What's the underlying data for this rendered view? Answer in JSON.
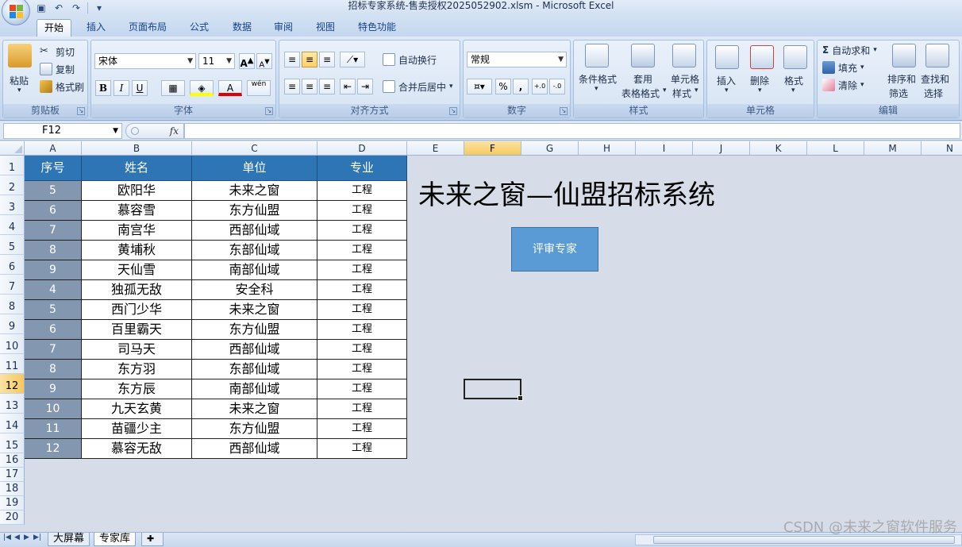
{
  "window": {
    "title": "招标专家系统-售卖授权2025052902.xlsm  -  Microsoft Excel"
  },
  "ribbon": {
    "tabs": [
      "开始",
      "插入",
      "页面布局",
      "公式",
      "数据",
      "审阅",
      "视图",
      "特色功能"
    ],
    "active_tab": "开始",
    "clipboard": {
      "paste": "粘贴",
      "cut": "剪切",
      "copy": "复制",
      "format_painter": "格式刷",
      "label": "剪贴板"
    },
    "font": {
      "family": "宋体",
      "size": "11",
      "label": "字体",
      "bold": "B",
      "italic": "I",
      "underline": "U",
      "grow": "A",
      "shrink": "A",
      "font_color_glyph": "A",
      "phonetic": "wén"
    },
    "alignment": {
      "wrap": "自动换行",
      "merge": "合并后居中",
      "label": "对齐方式"
    },
    "number": {
      "format": "常规",
      "percent": "%",
      "comma": ",",
      "label": "数字",
      "inc_decimal": "+.0",
      "dec_decimal": "-.0"
    },
    "styles": {
      "conditional": "条件格式",
      "table_format_1": "套用",
      "table_format_2": "表格格式",
      "cell_style_1": "单元格",
      "cell_style_2": "样式",
      "label": "样式"
    },
    "cells": {
      "insert": "插入",
      "delete": "删除",
      "format": "格式",
      "label": "单元格"
    },
    "editing": {
      "autosum": "自动求和",
      "fill": "填充",
      "clear": "清除",
      "sort_1": "排序和",
      "sort_2": "筛选",
      "find_1": "查找和",
      "find_2": "选择",
      "label": "编辑"
    }
  },
  "formula_bar": {
    "name_box": "F12",
    "fx": "fx",
    "formula": ""
  },
  "columns": [
    "A",
    "B",
    "C",
    "D",
    "E",
    "F",
    "G",
    "H",
    "I",
    "J",
    "K",
    "L",
    "M",
    "N"
  ],
  "selected_column": "F",
  "rows": [
    "1",
    "2",
    "3",
    "4",
    "5",
    "6",
    "7",
    "8",
    "9",
    "10",
    "11",
    "12",
    "13",
    "14",
    "15",
    "16",
    "17",
    "18",
    "19",
    "20"
  ],
  "selected_row": "12",
  "table": {
    "headers": [
      "序号",
      "姓名",
      "单位",
      "专业"
    ],
    "rows": [
      [
        "5",
        "欧阳华",
        "未来之窗",
        "工程"
      ],
      [
        "6",
        "慕容雪",
        "东方仙盟",
        "工程"
      ],
      [
        "7",
        "南宫华",
        "西部仙域",
        "工程"
      ],
      [
        "8",
        "黄埔秋",
        "东部仙域",
        "工程"
      ],
      [
        "9",
        "天仙雪",
        "南部仙域",
        "工程"
      ],
      [
        "4",
        "独孤无敌",
        "安全科",
        "工程"
      ],
      [
        "5",
        "西门少华",
        "未来之窗",
        "工程"
      ],
      [
        "6",
        "百里霸天",
        "东方仙盟",
        "工程"
      ],
      [
        "7",
        "司马天",
        "西部仙域",
        "工程"
      ],
      [
        "8",
        "东方羽",
        "东部仙域",
        "工程"
      ],
      [
        "9",
        "东方辰",
        "南部仙域",
        "工程"
      ],
      [
        "10",
        "九天玄黄",
        "未来之窗",
        "工程"
      ],
      [
        "11",
        "苗疆少主",
        "东方仙盟",
        "工程"
      ],
      [
        "12",
        "慕容无敌",
        "西部仙域",
        "工程"
      ]
    ]
  },
  "sheet_title": "未来之窗—仙盟招标系统",
  "action_button": "评审专家",
  "sheets": [
    "大屏幕",
    "专家库"
  ],
  "active_sheet": "专家库",
  "watermark": "CSDN @未来之窗软件服务"
}
